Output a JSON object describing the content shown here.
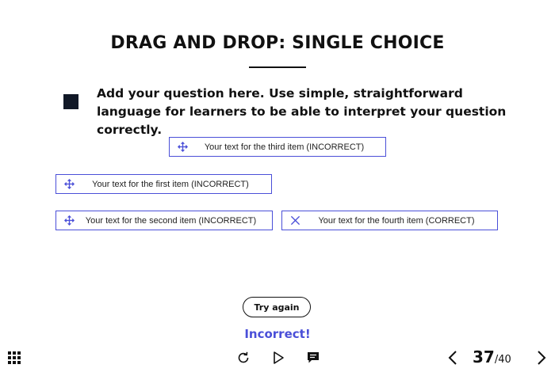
{
  "slide": {
    "title": "DRAG AND DROP: SINGLE CHOICE",
    "question": "Add your question here. Use simple, straightforward language for learners to be able to interpret your question correctly."
  },
  "items": {
    "third": {
      "label": "Your text for the third item (INCORRECT)",
      "icon": "move-icon"
    },
    "first": {
      "label": "Your text for the first item (INCORRECT)",
      "icon": "move-icon"
    },
    "second": {
      "label": "Your text for the second item (INCORRECT)",
      "icon": "move-icon"
    },
    "fourth": {
      "label": "Your text for the fourth item (CORRECT)",
      "icon": "close-icon"
    }
  },
  "actions": {
    "try_again_label": "Try again",
    "feedback": "Incorrect!"
  },
  "player": {
    "icons": [
      "grid-menu-icon",
      "reload-icon",
      "play-icon",
      "comment-icon",
      "chevron-left-icon",
      "chevron-right-icon"
    ],
    "current_page": "37",
    "total_pages": "/40"
  },
  "colors": {
    "accent": "#4a4fd8",
    "text": "#111111",
    "background": "#ffffff"
  }
}
